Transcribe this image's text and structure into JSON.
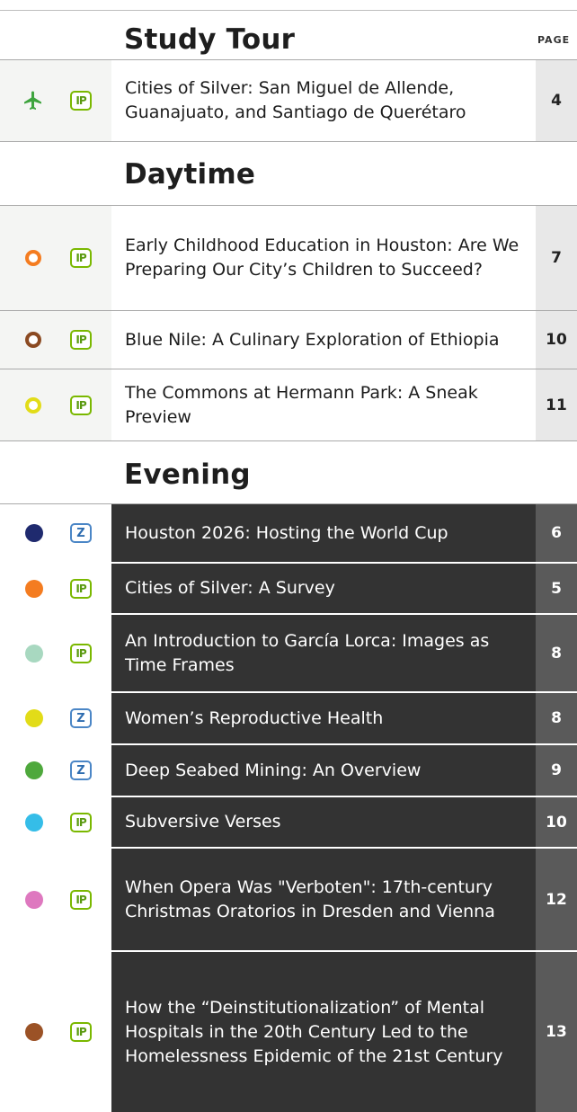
{
  "page_column_label": "PAGE",
  "sections": [
    {
      "heading": "Study Tour",
      "rows": [
        {
          "marker": "plane",
          "color": "#3ea43e",
          "badge": "IP",
          "title": "Cities of Silver: San Miguel de Allende, Guanajuato, and Santiago de Querétaro",
          "page": "4"
        }
      ]
    },
    {
      "heading": "Daytime",
      "rows": [
        {
          "marker": "ring",
          "color": "#f47c20",
          "badge": "IP",
          "title": "Early Childhood Education in Houston: Are We Preparing Our City’s Children to Succeed?",
          "page": "7"
        },
        {
          "marker": "ring",
          "color": "#8b4a22",
          "badge": "IP",
          "title": "Blue Nile: A Culinary Exploration of Ethiopia",
          "page": "10"
        },
        {
          "marker": "ring",
          "color": "#e2dc18",
          "badge": "IP",
          "title": "The Commons at Hermann Park: A Sneak Preview",
          "page": "11"
        }
      ]
    },
    {
      "heading": "Evening",
      "rows": [
        {
          "marker": "dot",
          "color": "#1f2a6e",
          "badge": "Z",
          "title": "Houston 2026: Hosting the World Cup",
          "page": "6"
        },
        {
          "marker": "dot",
          "color": "#f47c20",
          "badge": "IP",
          "title": "Cities of Silver: A Survey",
          "page": "5"
        },
        {
          "marker": "dot",
          "color": "#a8d8c0",
          "badge": "IP",
          "title": "An Introduction to García Lorca: Images as Time Frames",
          "page": "8"
        },
        {
          "marker": "dot",
          "color": "#e2dc18",
          "badge": "Z",
          "title": "Women’s Reproductive Health",
          "page": "8"
        },
        {
          "marker": "dot",
          "color": "#4ea83c",
          "badge": "Z",
          "title": "Deep Seabed Mining: An Overview",
          "page": "9"
        },
        {
          "marker": "dot",
          "color": "#35bde8",
          "badge": "IP",
          "title": "Subversive Verses",
          "page": "10"
        },
        {
          "marker": "dot",
          "color": "#de78bf",
          "badge": "IP",
          "title": "When Opera Was \"Verboten\": 17th-century Christmas Oratorios in Dresden and Vienna",
          "page": "12"
        },
        {
          "marker": "dot",
          "color": "#9b5226",
          "badge": "IP",
          "title": "How the “Deinstitutionalization” of Mental Hospitals in the 20th Century Led to the Homelessness Epidemic of the 21st Century",
          "page": "13"
        }
      ]
    }
  ]
}
